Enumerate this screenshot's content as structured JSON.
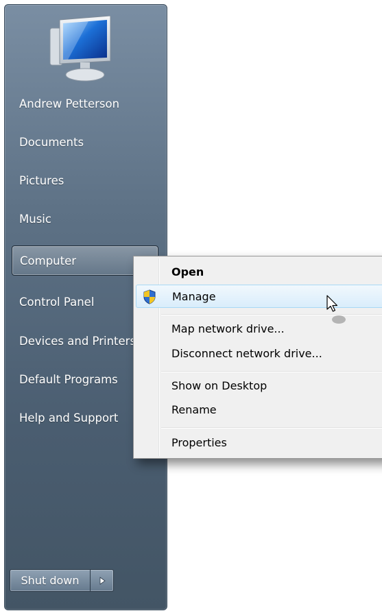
{
  "start_menu": {
    "items": [
      {
        "label": "Andrew Petterson"
      },
      {
        "label": "Documents"
      },
      {
        "label": "Pictures"
      },
      {
        "label": "Music"
      },
      {
        "label": "Computer"
      },
      {
        "label": "Control Panel"
      },
      {
        "label": "Devices and Printers"
      },
      {
        "label": "Default Programs"
      },
      {
        "label": "Help and Support"
      }
    ],
    "shutdown_label": "Shut down",
    "icons": {
      "user_picture": "computer-monitor-icon",
      "shutdown_arrow": "triangle-right-icon"
    }
  },
  "context_menu": {
    "items": [
      {
        "label": "Open",
        "bold": true
      },
      {
        "label": "Manage",
        "icon": "uac-shield-icon",
        "highlighted": true
      },
      {
        "label": "Map network drive..."
      },
      {
        "label": "Disconnect network drive..."
      },
      {
        "label": "Show on Desktop"
      },
      {
        "label": "Rename"
      },
      {
        "label": "Properties"
      }
    ]
  },
  "colors": {
    "pane_top": "#7a8ea3",
    "pane_bottom": "#435565",
    "menu_bg": "#f0f0f0",
    "hover_border": "#a8d8f5"
  }
}
